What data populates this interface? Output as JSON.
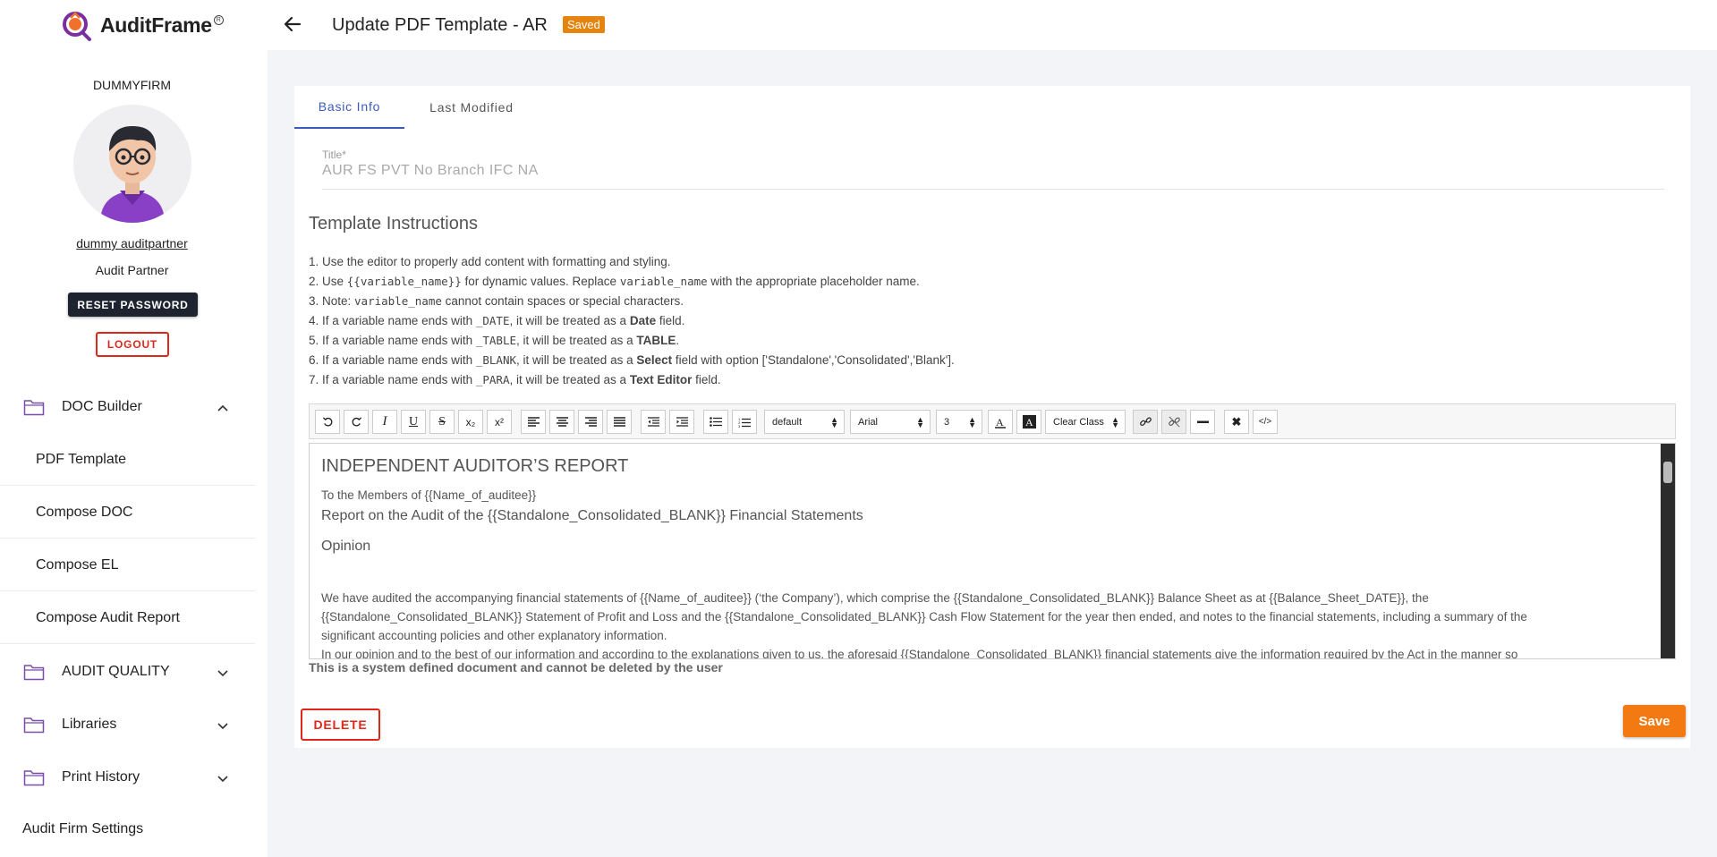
{
  "app": {
    "logo_text": "AuditFrame",
    "logo_mark": "R"
  },
  "sidebar": {
    "firm_name": "DUMMYFIRM",
    "user_name": "dummy auditpartner",
    "user_role": "Audit Partner",
    "reset_label": "RESET PASSWORD",
    "logout_label": "LOGOUT",
    "groups": [
      {
        "label": "DOC Builder",
        "expanded": true,
        "items": [
          "PDF Template",
          "Compose DOC",
          "Compose EL",
          "Compose Audit Report"
        ]
      },
      {
        "label": "AUDIT QUALITY",
        "expanded": false
      },
      {
        "label": "Libraries",
        "expanded": false
      },
      {
        "label": "Print History",
        "expanded": false
      }
    ],
    "settings_label": "Audit Firm Settings"
  },
  "header": {
    "title": "Update PDF Template - AR",
    "badge": "Saved"
  },
  "tabs": [
    {
      "label": "Basic Info",
      "active": true
    },
    {
      "label": "Last Modified",
      "active": false
    }
  ],
  "form": {
    "title_label": "Title*",
    "title_value": "AUR FS PVT No Branch IFC NA"
  },
  "instructions": {
    "heading": "Template Instructions",
    "l1": "1. Use the editor to properly add content with formatting and styling.",
    "l2a": "2. Use ",
    "l2b": "{{variable_name}}",
    "l2c": " for dynamic values. Replace ",
    "l2d": "variable_name",
    "l2e": " with the appropriate placeholder name.",
    "l3a": "3. Note: ",
    "l3b": "variable_name",
    "l3c": " cannot contain spaces or special characters.",
    "l4a": "4. If a variable name ends with ",
    "l4b": "_DATE",
    "l4c": ", it will be treated as a ",
    "l4d": "Date",
    "l4e": " field.",
    "l5a": "5. If a variable name ends with ",
    "l5b": "_TABLE",
    "l5c": ", it will be treated as a ",
    "l5d": "TABLE",
    "l5e": ".",
    "l6a": "6. If a variable name ends with ",
    "l6b": "_BLANK",
    "l6c": ", it will be treated as a ",
    "l6d": "Select",
    "l6e": " field with option ['Standalone','Consolidated','Blank'].",
    "l7a": "7. If a variable name ends with ",
    "l7b": "_PARA",
    "l7c": ", it will be treated as a ",
    "l7d": "Text Editor",
    "l7e": " field."
  },
  "toolbar": {
    "format_select": "default",
    "font_select": "Arial",
    "size_select": "3",
    "class_select": "Clear Class"
  },
  "editor": {
    "heading": "INDEPENDENT AUDITOR’S REPORT",
    "line1": "To the Members of {{Name_of_auditee}}",
    "line2": "Report on the Audit of the {{Standalone_Consolidated_BLANK}} Financial Statements",
    "line3": "Opinion",
    "para1a": "We have audited the accompanying financial statements of {{Name_of_auditee}} (‘the Company’), which comprise the {{Standalone_Consolidated_BLANK}} Balance Sheet as at {{Balance_Sheet_DATE}}, the",
    "para1b": "{{Standalone_Consolidated_BLANK}} Statement of Profit and Loss and the {{Standalone_Consolidated_BLANK}} Cash Flow Statement for the year then ended, and notes to the financial statements, including a summary of the",
    "para1c": "significant accounting policies and other explanatory information.",
    "para2": "In our opinion and to the best of our information and according to the explanations given to us, the aforesaid {{Standalone_Consolidated_BLANK}} financial statements give the information required by the Act in the manner so"
  },
  "system_note": "This is a system defined document and cannot be deleted by the user",
  "actions": {
    "delete_label": "DELETE",
    "save_label": "Save"
  },
  "colors": {
    "accent": "#3b5bbb",
    "save": "#f37a12",
    "danger": "#e0281a",
    "badge": "#e5850f",
    "folder": "#7a4fa8"
  }
}
